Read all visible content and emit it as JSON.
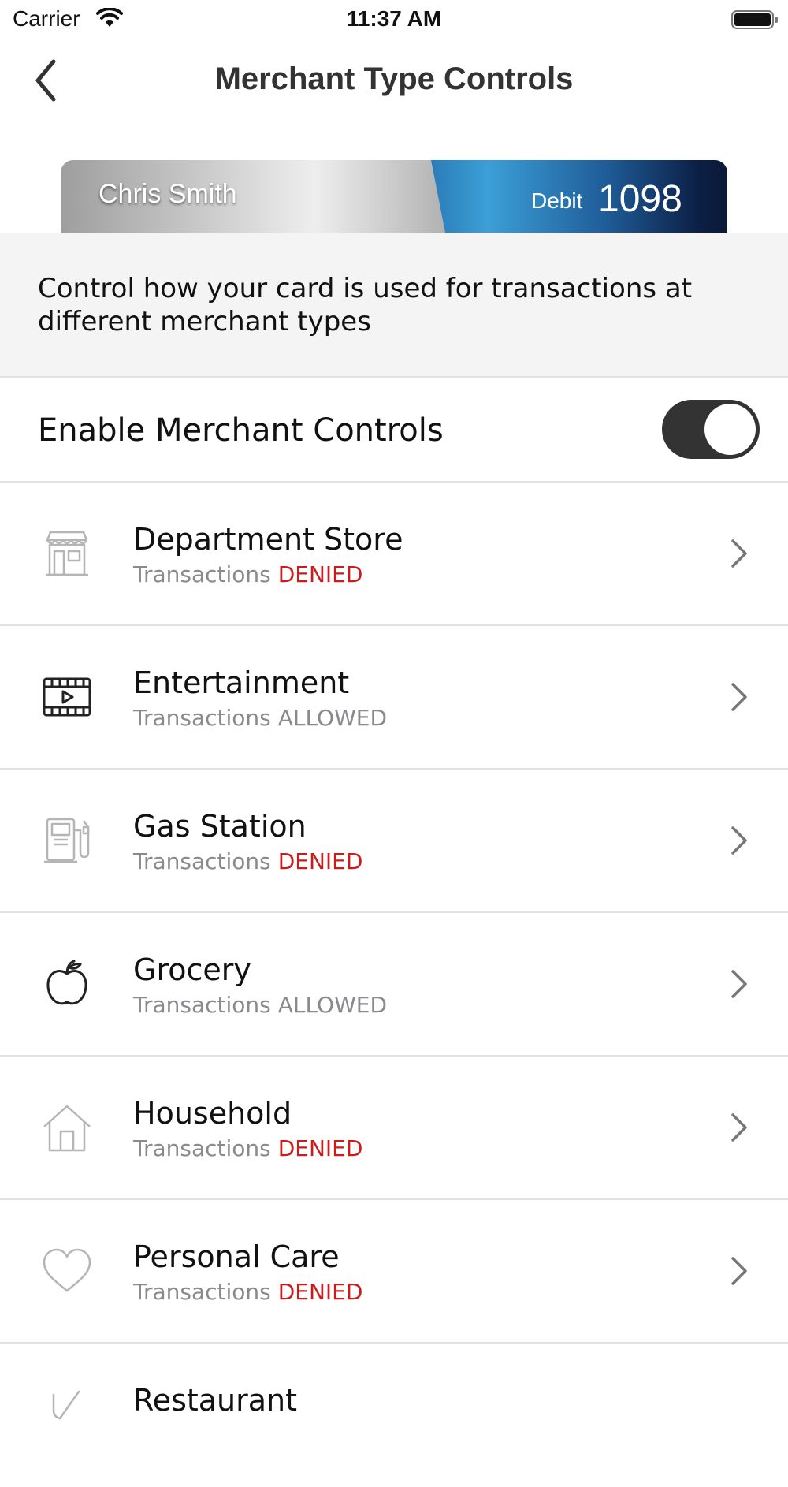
{
  "status_bar": {
    "carrier": "Carrier",
    "time": "11:37 AM"
  },
  "nav": {
    "title": "Merchant Type Controls",
    "back_icon": "chevron-left-icon"
  },
  "card": {
    "holder_name": "Chris Smith",
    "type": "Debit",
    "last4": "1098"
  },
  "description": "Control how your card is used for transactions at different merchant types",
  "merchant_controls": {
    "label": "Enable Merchant Controls",
    "enabled": true
  },
  "colors": {
    "denied": "#cc1b1b",
    "allowed": "#8a8a8e",
    "toggle_on": "#333333"
  },
  "merchants": [
    {
      "name": "Department Store",
      "status_prefix": "Transactions",
      "status": "DENIED",
      "icon": "store-icon"
    },
    {
      "name": "Entertainment",
      "status_prefix": "Transactions",
      "status": "ALLOWED",
      "icon": "film-icon"
    },
    {
      "name": "Gas Station",
      "status_prefix": "Transactions",
      "status": "DENIED",
      "icon": "gas-pump-icon"
    },
    {
      "name": "Grocery",
      "status_prefix": "Transactions",
      "status": "ALLOWED",
      "icon": "apple-icon"
    },
    {
      "name": "Household",
      "status_prefix": "Transactions",
      "status": "DENIED",
      "icon": "house-icon"
    },
    {
      "name": "Personal Care",
      "status_prefix": "Transactions",
      "status": "DENIED",
      "icon": "heart-icon"
    },
    {
      "name": "Restaurant",
      "status_prefix": "",
      "status": "",
      "icon": "utensils-icon"
    }
  ]
}
